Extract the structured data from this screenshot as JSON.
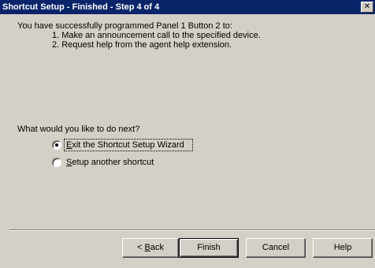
{
  "window": {
    "title": "Shortcut Setup - Finished - Step 4 of 4",
    "close_label": "✕"
  },
  "summary": {
    "intro": "You have successfully programmed Panel 1 Button 2 to:",
    "steps": [
      "1. Make an announcement call to the specified device.",
      "2. Request help from the agent help extension."
    ]
  },
  "next": {
    "question": "What would you like to do next?",
    "options": [
      {
        "label": "Exit the Shortcut Setup Wizard",
        "accel": "E",
        "rest": "xit the Shortcut Setup Wizard",
        "selected": true
      },
      {
        "label": "Setup another shortcut",
        "accel": "S",
        "rest": "etup another shortcut",
        "selected": false
      }
    ]
  },
  "buttons": {
    "back": {
      "label": "< Back",
      "prefix": "< ",
      "accel": "B",
      "rest": "ack"
    },
    "finish": "Finish",
    "cancel": "Cancel",
    "help": "Help"
  },
  "colors": {
    "titlebar": "#0a246a",
    "dialog_face": "#d4d0c8"
  }
}
